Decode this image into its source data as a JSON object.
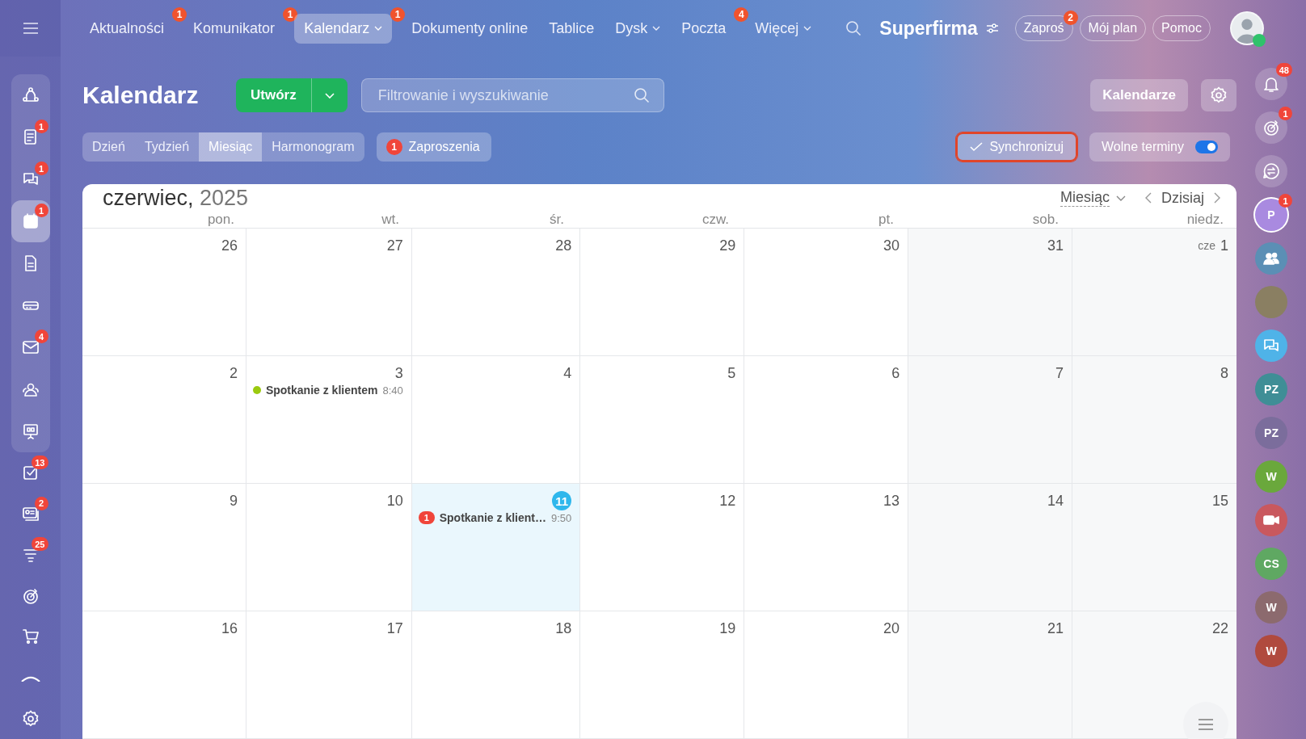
{
  "top_nav": {
    "items": [
      {
        "label": "Aktualności",
        "badge": "1",
        "selected": false,
        "dropdown": false
      },
      {
        "label": "Komunikator",
        "badge": "1",
        "selected": false,
        "dropdown": false
      },
      {
        "label": "Kalendarz",
        "badge": "1",
        "selected": true,
        "dropdown": true
      },
      {
        "label": "Dokumenty online",
        "selected": false,
        "dropdown": false
      },
      {
        "label": "Tablice",
        "selected": false,
        "dropdown": false
      },
      {
        "label": "Dysk",
        "selected": false,
        "dropdown": true
      },
      {
        "label": "Poczta",
        "badge": "4",
        "selected": false,
        "dropdown": false
      },
      {
        "label": "Więcej",
        "selected": false,
        "dropdown": true
      }
    ],
    "company": "Superfirma",
    "buttons": [
      {
        "label": "Zaproś",
        "badge": "2"
      },
      {
        "label": "Mój plan"
      },
      {
        "label": "Pomoc"
      }
    ]
  },
  "sidebar": {
    "group": [
      {
        "kind": "network",
        "selected": false
      },
      {
        "kind": "feed",
        "badge": "1",
        "selected": false
      },
      {
        "kind": "chat",
        "badge": "1",
        "selected": false
      },
      {
        "kind": "calendar",
        "badge": "1",
        "selected": true
      },
      {
        "kind": "document",
        "selected": false
      },
      {
        "kind": "drive",
        "selected": false
      },
      {
        "kind": "mail",
        "badge": "4",
        "selected": false
      },
      {
        "kind": "people",
        "selected": false
      },
      {
        "kind": "board",
        "selected": false
      }
    ],
    "items": [
      {
        "kind": "tasks",
        "badge": "13",
        "selected": false
      },
      {
        "kind": "crm",
        "badge": "2",
        "selected": false
      },
      {
        "kind": "funnel",
        "badge": "25",
        "selected": false
      },
      {
        "kind": "target",
        "selected": false
      },
      {
        "kind": "cart",
        "selected": false
      },
      {
        "kind": "collapse",
        "selected": false
      },
      {
        "kind": "settings",
        "selected": false
      }
    ]
  },
  "page": {
    "title": "Kalendarz",
    "create_button": "Utwórz",
    "search": {
      "placeholder": "Filtrowanie i wyszukiwanie"
    },
    "calendars_button": "Kalendarze",
    "view_tabs": [
      {
        "label": "Dzień",
        "selected": false
      },
      {
        "label": "Tydzień",
        "selected": false
      },
      {
        "label": "Miesiąc",
        "selected": true
      },
      {
        "label": "Harmonogram",
        "selected": false
      }
    ],
    "invitations": {
      "badge": "1",
      "label": "Zaproszenia"
    },
    "sync": {
      "label": "Synchronizuj",
      "highlighted": true
    },
    "free_slots": {
      "label": "Wolne terminy",
      "on": true
    }
  },
  "calendar": {
    "month": "czerwiec,",
    "year": "2025",
    "view": "Miesiąc",
    "today_button": "Dzisiaj",
    "weekdays": [
      "pon.",
      "wt.",
      "śr.",
      "czw.",
      "pt.",
      "sob.",
      "niedz."
    ],
    "weeks": [
      [
        {
          "day": "26"
        },
        {
          "day": "27"
        },
        {
          "day": "28"
        },
        {
          "day": "29"
        },
        {
          "day": "30"
        },
        {
          "day": "31"
        },
        {
          "prefix": "cze",
          "day": "1"
        }
      ],
      [
        {
          "day": "2"
        },
        {
          "day": "3",
          "events": [
            {
              "kind": "dot",
              "color": "#9bca0f",
              "title": "Spotkanie z klientem",
              "time": "8:40"
            }
          ]
        },
        {
          "day": "4"
        },
        {
          "day": "5"
        },
        {
          "day": "6"
        },
        {
          "day": "7"
        },
        {
          "day": "8"
        }
      ],
      [
        {
          "day": "9"
        },
        {
          "day": "10"
        },
        {
          "day": "11",
          "today": true,
          "events": [
            {
              "kind": "badge",
              "badge": "1",
              "title": "Spotkanie z klient…",
              "time": "9:50"
            }
          ]
        },
        {
          "day": "12"
        },
        {
          "day": "13"
        },
        {
          "day": "14"
        },
        {
          "day": "15"
        }
      ],
      [
        {
          "day": "16"
        },
        {
          "day": "17"
        },
        {
          "day": "18"
        },
        {
          "day": "19"
        },
        {
          "day": "20"
        },
        {
          "day": "21"
        },
        {
          "day": "22"
        }
      ]
    ]
  },
  "right_rail": {
    "items": [
      {
        "kind": "bell",
        "badge": "48"
      },
      {
        "kind": "target",
        "badge": "1"
      },
      {
        "kind": "exchange"
      },
      {
        "kind": "letter",
        "text": "P",
        "color": "#a98ae0",
        "badge": "1"
      },
      {
        "kind": "group",
        "color": "#5b8fb5"
      },
      {
        "kind": "photo",
        "color": "#8a7f62"
      },
      {
        "kind": "chat",
        "color": "#4fb3e8"
      },
      {
        "kind": "letter",
        "text": "PZ",
        "color": "#3f8e96"
      },
      {
        "kind": "letter",
        "text": "PZ",
        "color": "#7b6d9c"
      },
      {
        "kind": "letter",
        "text": "W",
        "color": "#6aa83c"
      },
      {
        "kind": "video",
        "color": "#c9585e"
      },
      {
        "kind": "letter",
        "text": "CS",
        "color": "#5fa862"
      },
      {
        "kind": "letter",
        "text": "W",
        "color": "#8c6a6e"
      },
      {
        "kind": "letter",
        "text": "W",
        "color": "#b04a3e"
      }
    ]
  }
}
